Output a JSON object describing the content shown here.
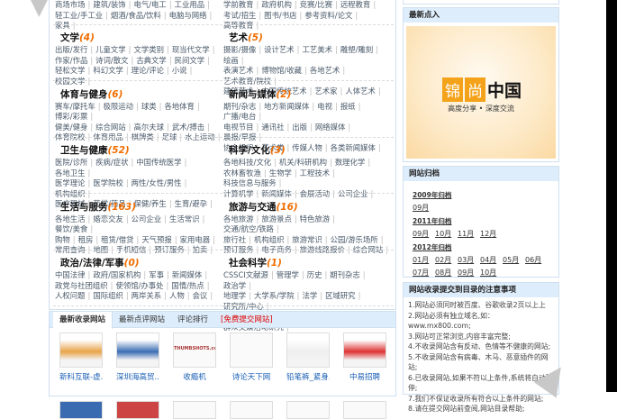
{
  "top_partial": {
    "left": [
      [
        "商场市场",
        "建筑/装饰",
        "电气/电工",
        "工业用品"
      ],
      [
        "轻工业/手工业",
        "烟酒/食品/饮料",
        "电脑与网络",
        "家具"
      ]
    ],
    "right": [
      [
        "学前教育",
        "政府机构",
        "竞赛/比赛",
        "远程教育"
      ],
      [
        "考试/招生",
        "图书/书店",
        "参考资料/论文",
        "高等教育"
      ]
    ]
  },
  "sections": [
    {
      "title": "文学",
      "count": "(4)",
      "links": [
        [
          "出版/发行",
          "儿童文学",
          "文学类别",
          "现当代文学"
        ],
        [
          "作家/作品",
          "诗词/散文",
          "古典文学",
          "民间文学"
        ],
        [
          "轻松文学",
          "科幻文学",
          "理论/评论",
          "小说",
          "校园文学"
        ]
      ]
    },
    {
      "title": "艺术",
      "count": "(5)",
      "links": [
        [
          "摄影/摄像",
          "设计艺术",
          "工艺美术",
          "雕塑/雕刻",
          "绘画"
        ],
        [
          "表演艺术",
          "博物馆/收藏",
          "各地艺术",
          "艺术教育/院校"
        ],
        [
          "建筑艺术",
          "中国传统艺术",
          "艺术家",
          "人体艺术"
        ]
      ]
    },
    {
      "title": "体育与健身",
      "count": "(6)",
      "links": [
        [
          "赛车/摩托车",
          "极限运动",
          "球类",
          "各地体育",
          "博彩/彩票"
        ],
        [
          "健美/健身",
          "综合网站",
          "高尔夫球",
          "武术/搏击"
        ],
        [
          "体育院校",
          "体育用品",
          "棋牌类",
          "足球",
          "水上运动"
        ]
      ]
    },
    {
      "title": "新闻与媒体",
      "count": "(2)",
      "links": [
        [
          "期刊/杂志",
          "地方新闻媒体",
          "电视",
          "报纸",
          "广播/电台"
        ],
        [
          "电视节目",
          "通讯社",
          "出版",
          "网络媒体",
          "晨报/早报"
        ],
        [
          "协会组织",
          "艺术类",
          "传媒人物",
          "各类新闻媒体"
        ]
      ]
    },
    {
      "title": "卫生与健康",
      "count": "(52)",
      "links": [
        [
          "医院/诊所",
          "疾病/症状",
          "中国传统医学",
          "各地卫生"
        ],
        [
          "医学理论",
          "医学院校",
          "两性/女性/男性",
          "机构组织"
        ],
        [
          "医疗器械",
          "药学/药品",
          "保健/养生",
          "生育/避孕"
        ]
      ]
    },
    {
      "title": "科学/文化",
      "count": "(3)",
      "links": [
        [
          "各地科技/文化",
          "机关/科研机构",
          "数理化学"
        ],
        [
          "农林畜牧渔",
          "生物学",
          "工程技术",
          "科技信息与服务"
        ],
        [
          "计算机学",
          "新闻媒体",
          "会展活动",
          "公司企业"
        ]
      ]
    },
    {
      "title": "生活与服务",
      "count": "(163)",
      "links": [
        [
          "各地生活",
          "婚恋交友",
          "公司企业",
          "生活常识",
          "餐饮/美食"
        ],
        [
          "购物",
          "租房",
          "租赁/借贷",
          "天气预报",
          "家用电器"
        ],
        [
          "常用查询",
          "地图",
          "手机短信",
          "预订服务",
          "拍卖"
        ]
      ]
    },
    {
      "title": "旅游与交通",
      "count": "(16)",
      "links": [
        [
          "各地旅游",
          "旅游景点",
          "特色旅游",
          "交通/航空/铁路"
        ],
        [
          "旅行社",
          "机构组织",
          "旅游常识",
          "公园/游乐场所"
        ],
        [
          "预订服务",
          "电子商务",
          "旅游线路报价",
          "综合网站"
        ]
      ]
    },
    {
      "title": "政治/法律/军事",
      "count": "(0)",
      "links": [
        [
          "中国法律",
          "政府/国家机构",
          "军事",
          "新闻媒体"
        ],
        [
          "政党与社团组织",
          "使领馆/办事处",
          "国情/热点"
        ],
        [
          "人权问题",
          "国际组织",
          "两岸关系",
          "人物",
          "会议"
        ]
      ]
    },
    {
      "title": "社会科学",
      "count": "(1)",
      "links": [
        [
          "CSSCI文献源",
          "管理学",
          "历史",
          "期刊杂志",
          "政治学"
        ],
        [
          "地理学",
          "大学系/学院",
          "法学",
          "区域研究",
          "研究所/中心"
        ],
        [
          "经济学",
          "汉学研究",
          "综合",
          "人口学",
          "群众文娱活动研究"
        ]
      ]
    }
  ],
  "tabs": {
    "items": [
      "最新收录网站",
      "最新点评网站",
      "评论排行",
      "[免费提交网站]"
    ],
    "thumbs": [
      "新科互联-虚..",
      "深圳海高贸..",
      "收瘾机",
      "诗论天下网",
      "铅笔裤_紧身..",
      "中易招聘"
    ],
    "thumb_placeholder": "THUMBSHOTS.com"
  },
  "sidebar": {
    "latest": {
      "title": "最新点入",
      "logo": [
        "锦",
        "尚",
        "中国"
      ],
      "slogan": "高度分享 • 深度交流"
    },
    "archive": {
      "title": "网站归档",
      "years": [
        {
          "label": "2009年归档",
          "months": [
            "09月"
          ]
        },
        {
          "label": "2011年归档",
          "months": [
            "09月",
            "10月",
            "11月",
            "12月"
          ]
        },
        {
          "label": "2012年归档",
          "months": [
            "01月",
            "02月",
            "03月",
            "04月",
            "05月",
            "06月",
            "07月",
            "08月",
            "09月",
            "10月"
          ]
        }
      ]
    },
    "rules": {
      "title": "网站收录提交到目录的注意事项",
      "items": [
        "1.网站必须同时被百度、谷歌收录2页以上上",
        "2.网站必须有独立域名,如：www.mx800.com;",
        "3.网站可正常浏览,内容丰富完整;",
        "4.不收录网站含有反动、色情等不健康的网站;",
        "5.不收录网站含有病毒、木马、恶意插件的网站;",
        "6.已收录网站,如果不符以上条件,系统将自动暂停;",
        "7.我们不保证收录所有符合以上条件的网站;",
        "8.请在提交网站前查阅,网站目录帮助;"
      ]
    }
  }
}
